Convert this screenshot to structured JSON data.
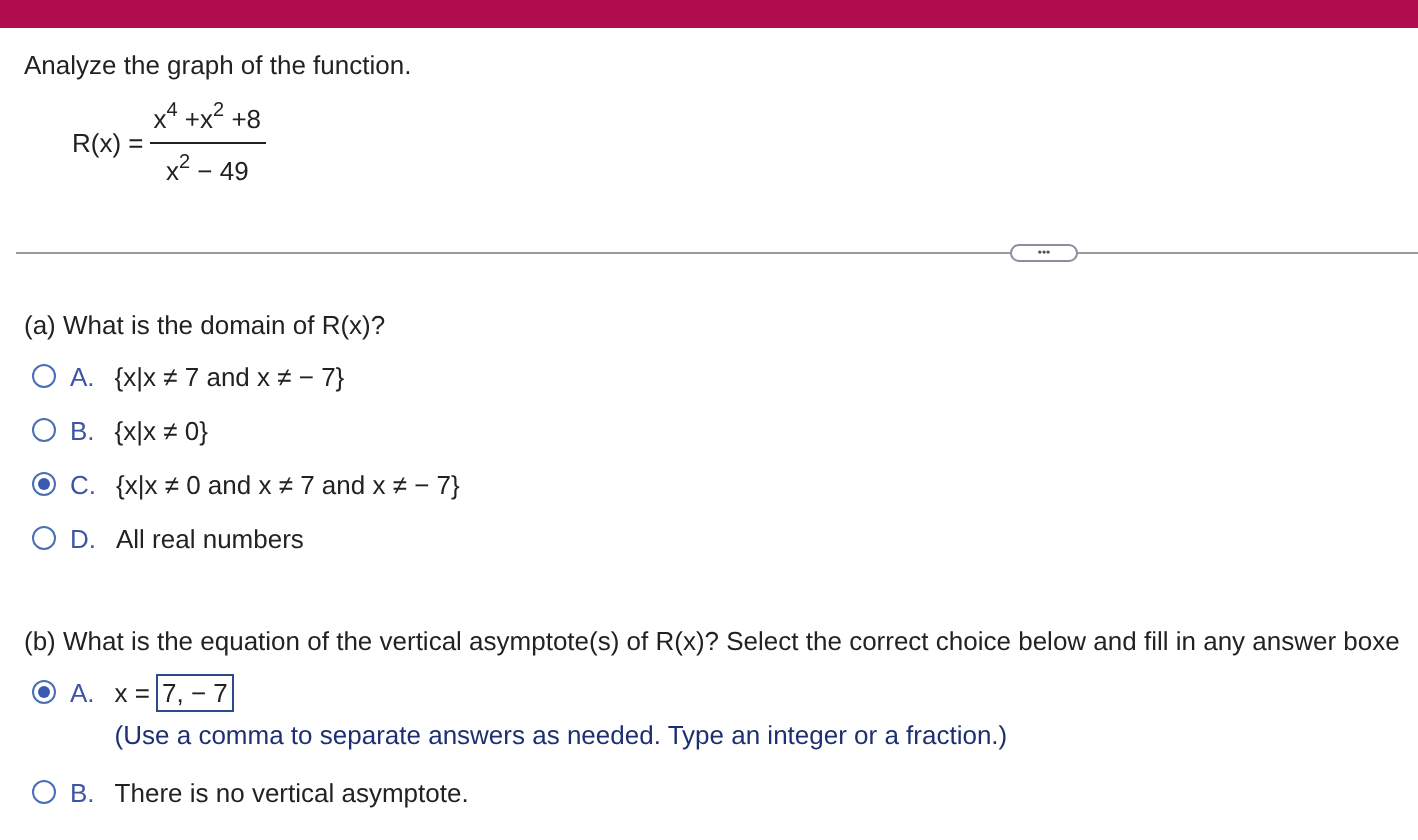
{
  "instruction": "Analyze the graph of the function.",
  "function": {
    "name": "R(x) =",
    "numerator": "x$^{4}$ +x$^{2}$ +8",
    "denominator": "x$^{2}$ − 49"
  },
  "divider_button": {
    "label": "•••"
  },
  "parts": [
    {
      "question": "(a)  What is the domain of R(x)?",
      "choices": [
        {
          "kind": "plain",
          "letter": "A.",
          "text": "{x|x ≠ 7 and x ≠ − 7}",
          "selected": false
        },
        {
          "kind": "plain",
          "letter": "B.",
          "text": "{x|x ≠ 0}",
          "selected": false
        },
        {
          "kind": "plain",
          "letter": "C.",
          "text": "{x|x ≠ 0 and x ≠ 7 and x ≠ − 7}",
          "selected": true
        },
        {
          "kind": "plain",
          "letter": "D.",
          "text": "All real numbers",
          "selected": false
        }
      ]
    },
    {
      "question": "(b)  What is the equation of the vertical asymptote(s) of R(x)?  Select the correct choice below and fill in any answer boxe",
      "choices": [
        {
          "kind": "answer",
          "letter": "A.",
          "prefix": "x =",
          "value": "7, − 7",
          "hint": "(Use a comma to separate answers as needed. Type an integer or a fraction.)",
          "selected": true
        },
        {
          "kind": "plain",
          "letter": "B.",
          "text": "There is no vertical asymptote.",
          "selected": false
        }
      ]
    }
  ]
}
